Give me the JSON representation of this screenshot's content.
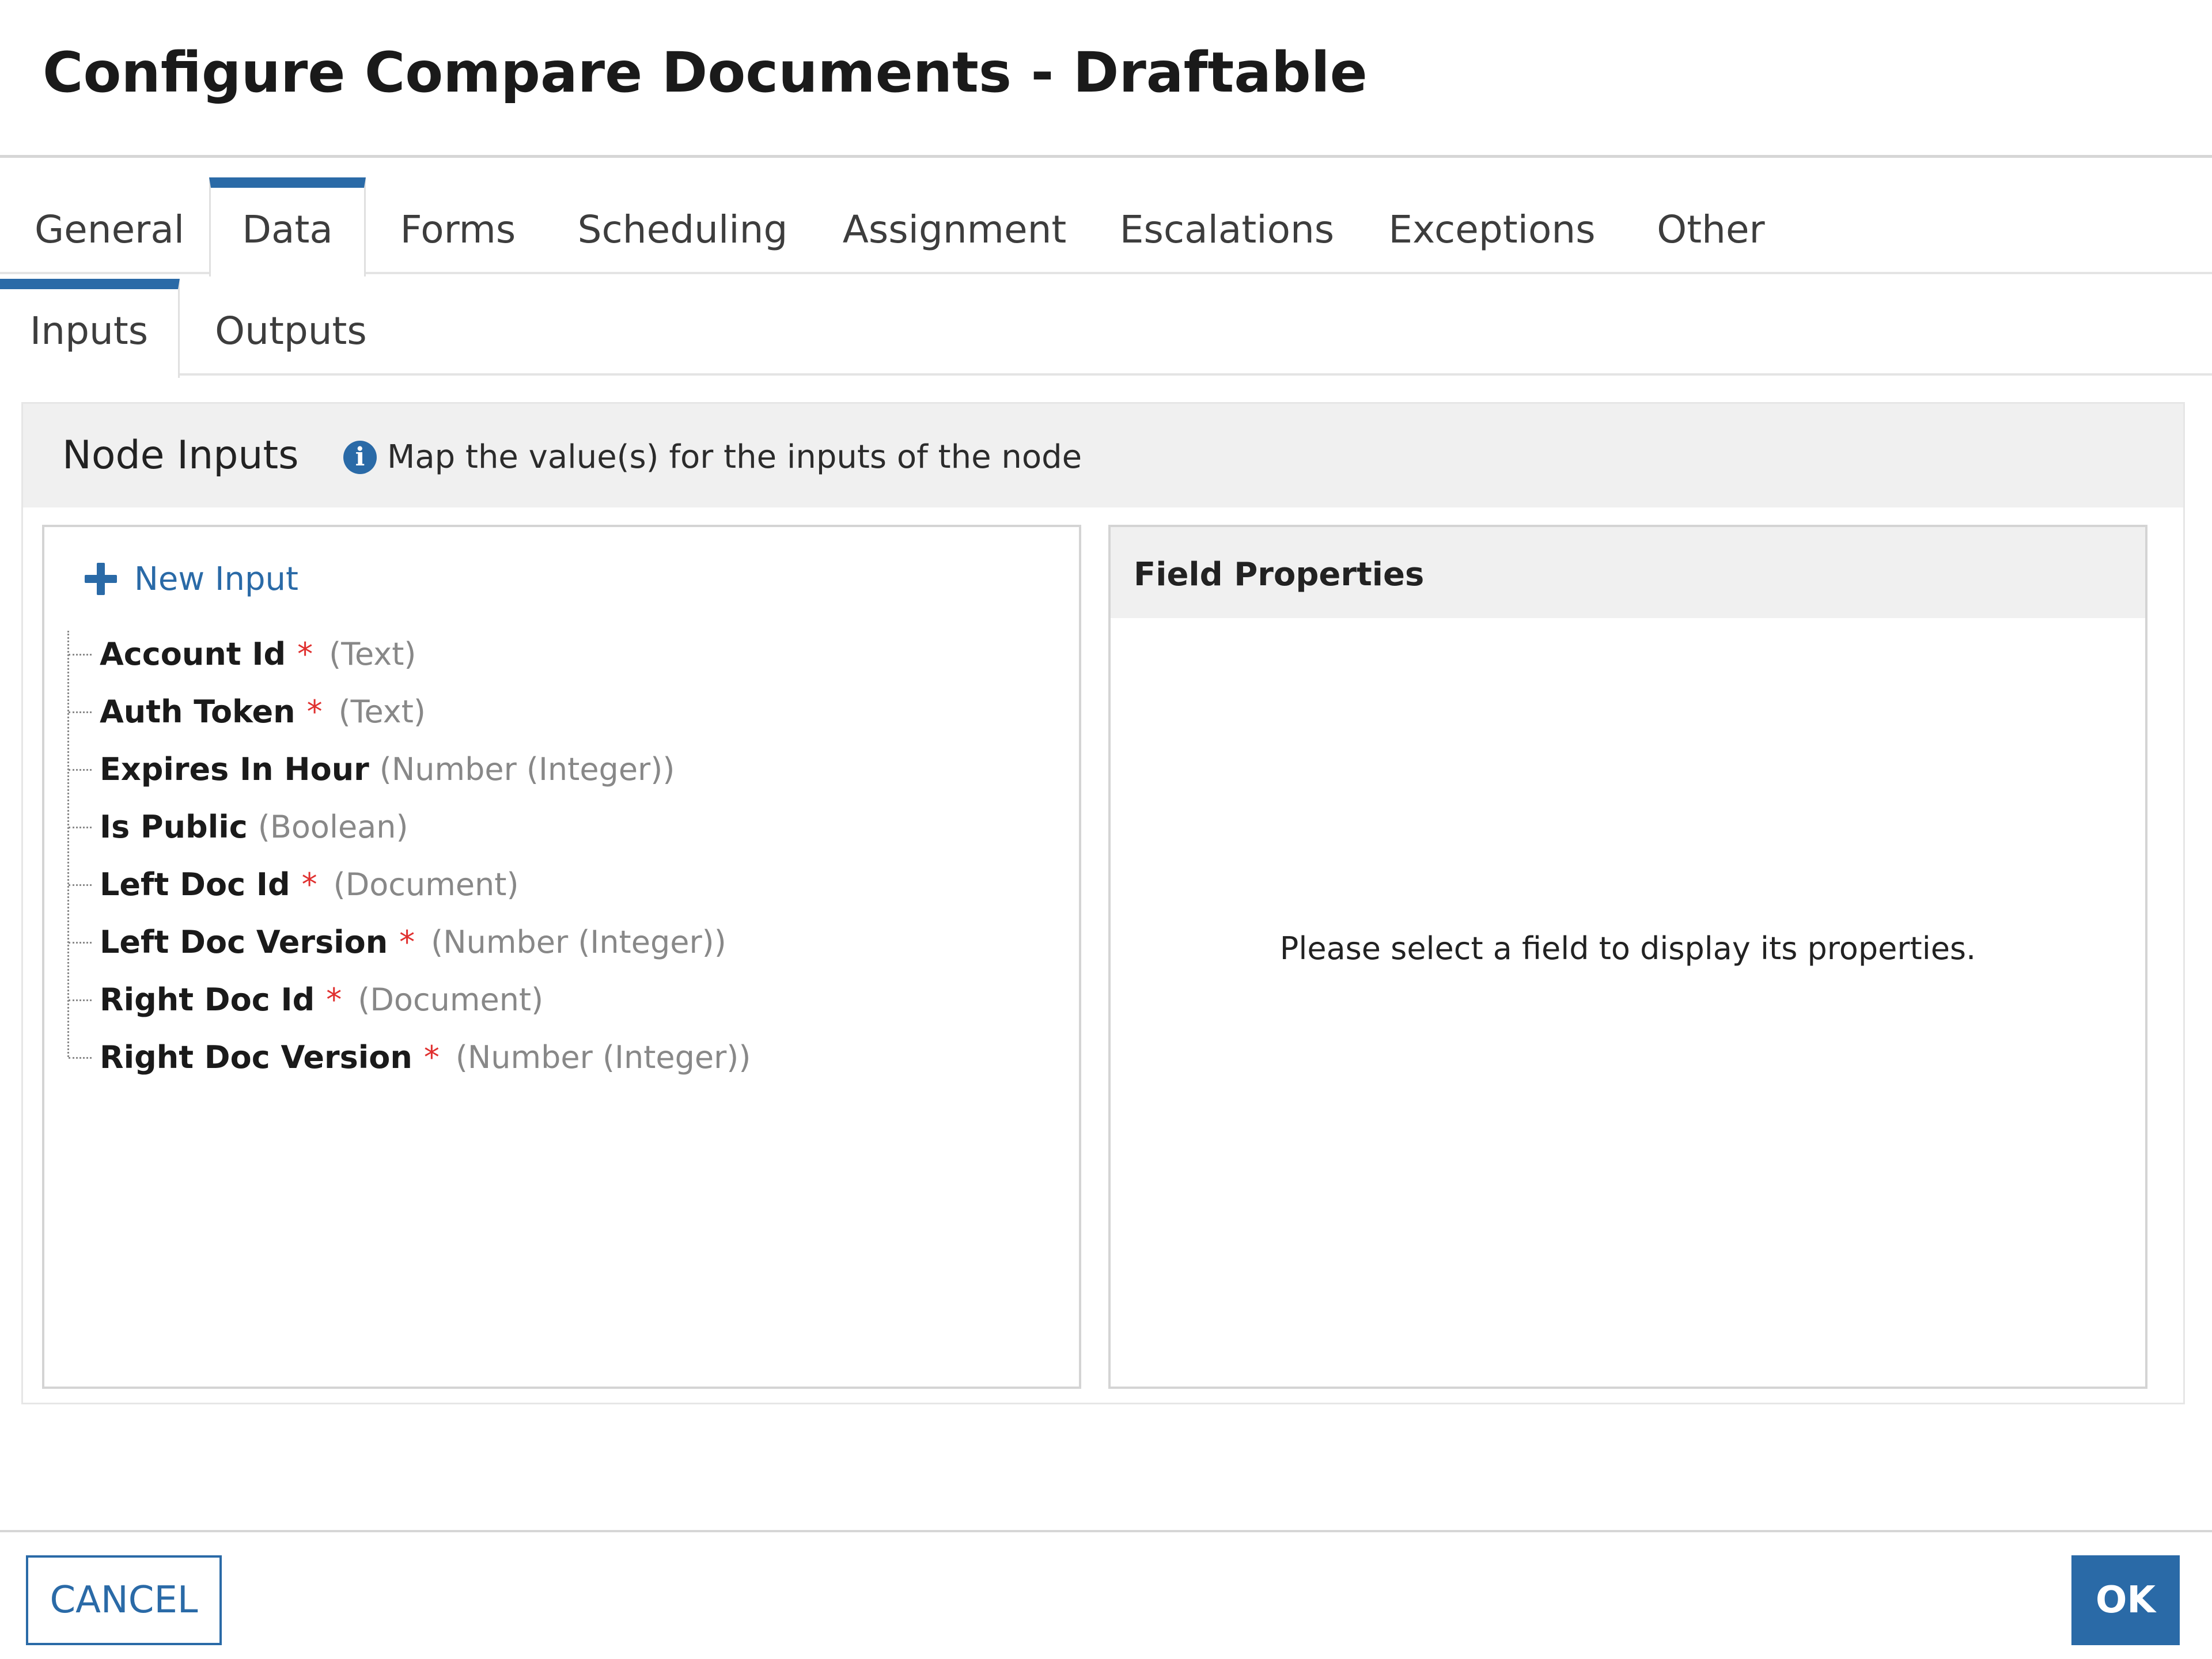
{
  "dialog": {
    "title": "Configure Compare Documents - Draftable"
  },
  "tabs": [
    {
      "label": "General"
    },
    {
      "label": "Data",
      "active": true
    },
    {
      "label": "Forms"
    },
    {
      "label": "Scheduling"
    },
    {
      "label": "Assignment"
    },
    {
      "label": "Escalations"
    },
    {
      "label": "Exceptions"
    },
    {
      "label": "Other"
    }
  ],
  "subtabs": [
    {
      "label": "Inputs",
      "active": true
    },
    {
      "label": "Outputs"
    }
  ],
  "node_inputs": {
    "title": "Node Inputs",
    "info_icon": "info-icon",
    "info_text": "Map the value(s) for the inputs of the node",
    "new_input_icon": "plus-icon",
    "new_input_label": "New Input",
    "required_marker": "*",
    "items": [
      {
        "name": "Account Id",
        "required": true,
        "type": "(Text)"
      },
      {
        "name": "Auth Token",
        "required": true,
        "type": "(Text)"
      },
      {
        "name": "Expires In Hour",
        "required": false,
        "type": "(Number (Integer))"
      },
      {
        "name": "Is Public",
        "required": false,
        "type": "(Boolean)"
      },
      {
        "name": "Left Doc Id",
        "required": true,
        "type": "(Document)"
      },
      {
        "name": "Left Doc Version",
        "required": true,
        "type": "(Number (Integer))"
      },
      {
        "name": "Right Doc Id",
        "required": true,
        "type": "(Document)"
      },
      {
        "name": "Right Doc Version",
        "required": true,
        "type": "(Number (Integer))"
      }
    ]
  },
  "field_properties": {
    "title": "Field Properties",
    "empty_message": "Please select a field to display its properties."
  },
  "footer": {
    "cancel_label": "CANCEL",
    "ok_label": "OK"
  },
  "colors": {
    "accent": "#2a6aa7",
    "required": "#e0302f",
    "panel_header_bg": "#f0f0f0"
  }
}
